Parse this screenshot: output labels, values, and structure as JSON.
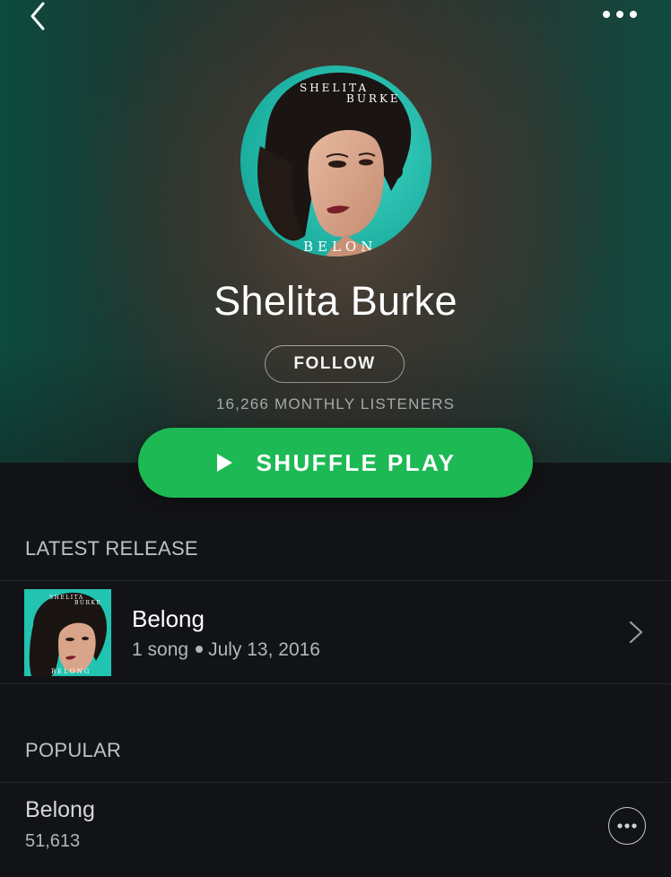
{
  "header": {
    "back_icon": "chevron-left-icon",
    "more_icon": "more-horizontal-icon"
  },
  "artist": {
    "name": "Shelita Burke",
    "avatar_text_top_1": "SHELITA",
    "avatar_text_top_2": "BURKE",
    "avatar_text_bottom": "BELON",
    "follow_label": "FOLLOW",
    "monthly_listeners": "16,266 MONTHLY LISTENERS"
  },
  "shuffle": {
    "label": "SHUFFLE PLAY",
    "icon": "play-icon"
  },
  "latest_release": {
    "section_title": "LATEST RELEASE",
    "title": "Belong",
    "song_count": "1 song",
    "date": "July 13, 2016",
    "cover_text_top_1": "SHELITA",
    "cover_text_top_2": "BURKE",
    "cover_text_bottom": "BELONG"
  },
  "popular": {
    "section_title": "POPULAR",
    "tracks": [
      {
        "title": "Belong",
        "plays": "51,613"
      }
    ]
  },
  "colors": {
    "accent_green": "#1db954",
    "background": "#121316",
    "cover_teal": "#1fbfae"
  }
}
